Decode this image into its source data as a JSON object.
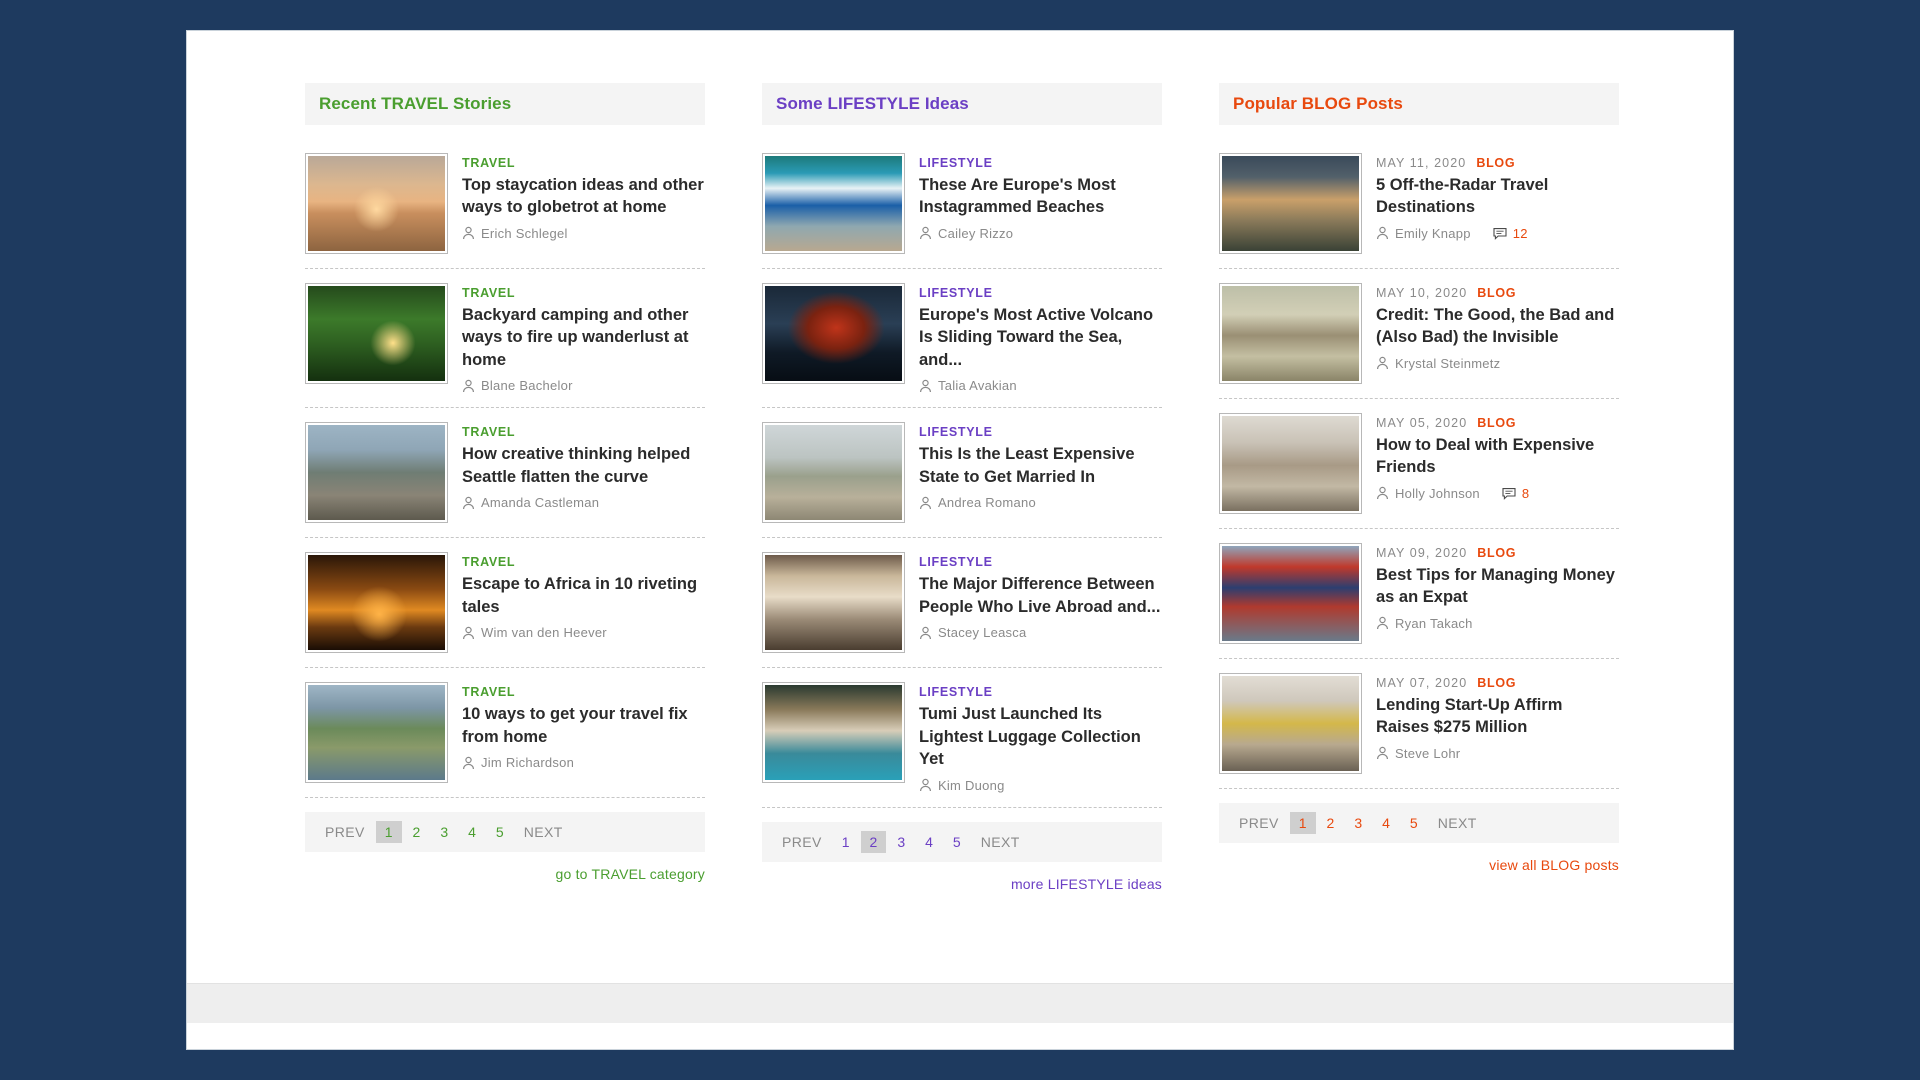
{
  "columns": [
    {
      "id": "travel",
      "theme": "travel",
      "header": "Recent TRAVEL Stories",
      "accent": "#4a9e2f",
      "articles": [
        {
          "image": "img-sunset-paddle",
          "image_name": "sunset-paddleboarder-photo",
          "tag": "TRAVEL",
          "title": "Top staycation ideas and other ways to globetrot at home",
          "author": "Erich Schlegel"
        },
        {
          "image": "img-backyard",
          "image_name": "backyard-garden-camping-photo",
          "tag": "TRAVEL",
          "title": "Backyard camping and other ways to fire up wanderlust at home",
          "author": "Blane Bachelor"
        },
        {
          "image": "img-street",
          "image_name": "seattle-street-scene-photo",
          "tag": "TRAVEL",
          "title": "How creative thinking helped Seattle flatten the curve",
          "author": "Amanda Castleman"
        },
        {
          "image": "img-africa-tree",
          "image_name": "africa-sunset-acacia-photo",
          "tag": "TRAVEL",
          "title": "Escape to Africa in 10 riveting tales",
          "author": "Wim van den Heever"
        },
        {
          "image": "img-coastal-town",
          "image_name": "coastal-town-aerial-photo",
          "tag": "TRAVEL",
          "title": "10 ways to get your travel fix from home",
          "author": "Jim Richardson"
        }
      ],
      "pagination": {
        "prev": "PREV",
        "next": "NEXT",
        "pages": [
          "1",
          "2",
          "3",
          "4",
          "5"
        ],
        "current": "1"
      },
      "more_link": "go to TRAVEL category"
    },
    {
      "id": "lifestyle",
      "theme": "lifestyle",
      "header": "Some LIFESTYLE Ideas",
      "accent": "#6b3fc4",
      "articles": [
        {
          "image": "img-ocean-aerial",
          "image_name": "aerial-beach-waves-photo",
          "tag": "LIFESTYLE",
          "title": "These Are Europe's Most Instagrammed Beaches",
          "author": "Cailey Rizzo"
        },
        {
          "image": "img-volcano",
          "image_name": "erupting-volcano-photo",
          "tag": "LIFESTYLE",
          "title": "Europe's Most Active Volcano Is Sliding Toward the Sea, and...",
          "author": "Talia Avakian"
        },
        {
          "image": "img-desert-couple",
          "image_name": "desert-wedding-couple-photo",
          "tag": "LIFESTYLE",
          "title": "This Is the Least Expensive State to Get Married In",
          "author": "Andrea Romano"
        },
        {
          "image": "img-cafe",
          "image_name": "cafe-friends-dining-photo",
          "tag": "LIFESTYLE",
          "title": "The Major Difference Between People Who Live Abroad and...",
          "author": "Stacey Leasca"
        },
        {
          "image": "img-boat-man",
          "image_name": "man-on-boat-luggage-photo",
          "tag": "LIFESTYLE",
          "title": "Tumi Just Launched Its Lightest Luggage Collection Yet",
          "author": "Kim Duong"
        }
      ],
      "pagination": {
        "prev": "PREV",
        "next": "NEXT",
        "pages": [
          "1",
          "2",
          "3",
          "4",
          "5"
        ],
        "current": "2"
      },
      "more_link": "more LIFESTYLE ideas"
    },
    {
      "id": "blog",
      "theme": "blog",
      "header": "Popular BLOG Posts",
      "accent": "#e8490e",
      "articles": [
        {
          "image": "img-bhutan",
          "image_name": "bhutan-monastery-photo",
          "date": "MAY 11, 2020",
          "tag": "BLOG",
          "title": "5 Off-the-Radar Travel Destinations",
          "author": "Emily Knapp",
          "comments": "12"
        },
        {
          "image": "img-credit-cards",
          "image_name": "credit-cards-money-photo",
          "date": "MAY 10, 2020",
          "tag": "BLOG",
          "title": "Credit: The Good, the Bad and (Also Bad) the Invisible",
          "author": "Krystal Steinmetz"
        },
        {
          "image": "img-friends-home",
          "image_name": "friends-at-home-photo",
          "date": "MAY 05, 2020",
          "tag": "BLOG",
          "title": "How to Deal with Expensive Friends",
          "author": "Holly Johnson",
          "comments": "8"
        },
        {
          "image": "img-london",
          "image_name": "london-big-ben-photo",
          "date": "MAY 09, 2020",
          "tag": "BLOG",
          "title": "Best Tips for Managing Money as an Expat",
          "author": "Ryan Takach"
        },
        {
          "image": "img-office-sofa",
          "image_name": "office-lounge-meeting-photo",
          "date": "MAY 07, 2020",
          "tag": "BLOG",
          "title": "Lending Start-Up Affirm Raises $275 Million",
          "author": "Steve Lohr"
        }
      ],
      "pagination": {
        "prev": "PREV",
        "next": "NEXT",
        "pages": [
          "1",
          "2",
          "3",
          "4",
          "5"
        ],
        "current": "1"
      },
      "more_link": "view all BLOG posts"
    }
  ]
}
